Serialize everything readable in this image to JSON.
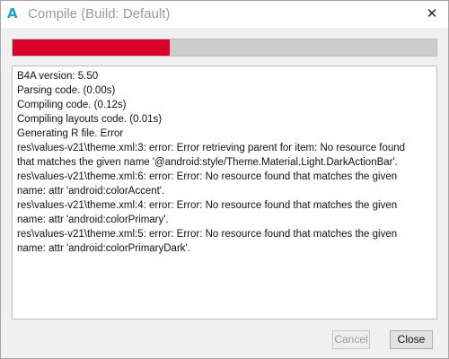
{
  "window": {
    "title": "Compile (Build: Default)",
    "app_icon": "A",
    "close_glyph": "✕"
  },
  "icons": {
    "app": "b4a-app-icon",
    "close": "close-icon"
  },
  "progress": {
    "value": 0.37,
    "color": "#d9002d"
  },
  "log": {
    "lines": [
      "B4A version: 5.50",
      "Parsing code.    (0.00s)",
      "Compiling code.    (0.12s)",
      "Compiling layouts code.    (0.01s)",
      "Generating R file.    Error",
      "res\\values-v21\\theme.xml:3: error: Error retrieving parent for item: No resource found",
      "that matches the given name '@android:style/Theme.Material.Light.DarkActionBar'.",
      "res\\values-v21\\theme.xml:6: error: Error: No resource found that matches the given",
      "name: attr 'android:colorAccent'.",
      "res\\values-v21\\theme.xml:4: error: Error: No resource found that matches the given",
      "name: attr 'android:colorPrimary'.",
      "res\\values-v21\\theme.xml:5: error: Error: No resource found that matches the given",
      "name: attr 'android:colorPrimaryDark'."
    ]
  },
  "buttons": {
    "cancel_label": "Cancel",
    "close_label": "Close"
  }
}
